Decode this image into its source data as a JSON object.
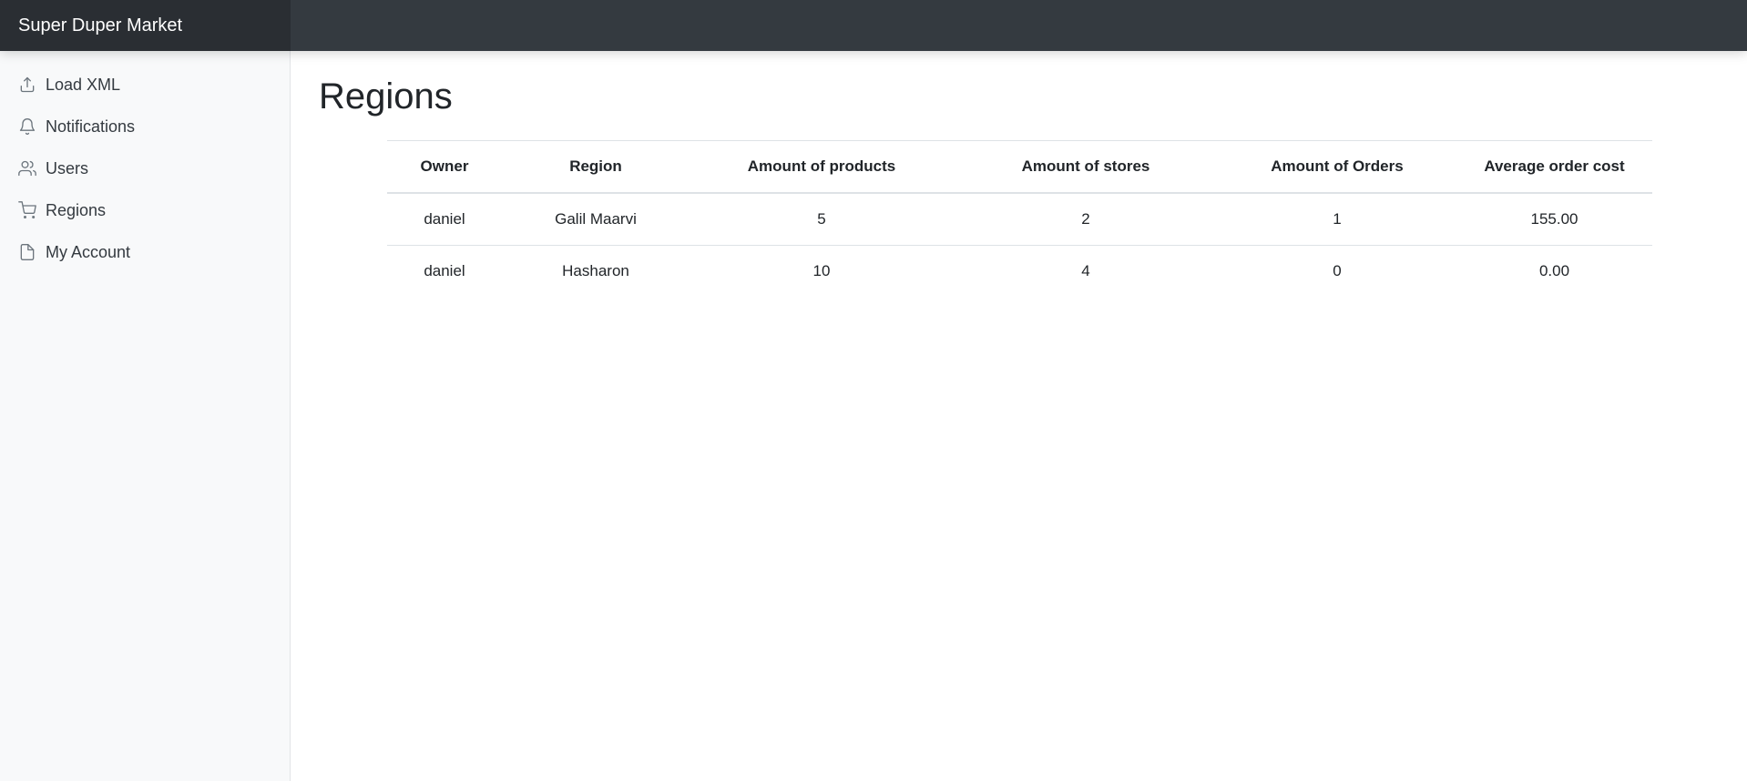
{
  "brand": "Super Duper Market",
  "sidebar": {
    "items": [
      {
        "label": "Load XML",
        "icon": "upload-icon"
      },
      {
        "label": "Notifications",
        "icon": "bell-icon"
      },
      {
        "label": "Users",
        "icon": "users-icon"
      },
      {
        "label": "Regions",
        "icon": "cart-icon"
      },
      {
        "label": "My Account",
        "icon": "file-icon"
      }
    ]
  },
  "main": {
    "title": "Regions",
    "table": {
      "headers": [
        "Owner",
        "Region",
        "Amount of products",
        "Amount of stores",
        "Amount of Orders",
        "Average order cost"
      ],
      "rows": [
        [
          "daniel",
          "Galil Maarvi",
          "5",
          "2",
          "1",
          "155.00"
        ],
        [
          "daniel",
          "Hasharon",
          "10",
          "4",
          "0",
          "0.00"
        ]
      ]
    }
  },
  "colors": {
    "navbar": "#343a40",
    "brand_bg": "#2a2e33",
    "sidebar_bg": "#f8f9fa",
    "text": "#212529",
    "border": "#dee2e6"
  }
}
